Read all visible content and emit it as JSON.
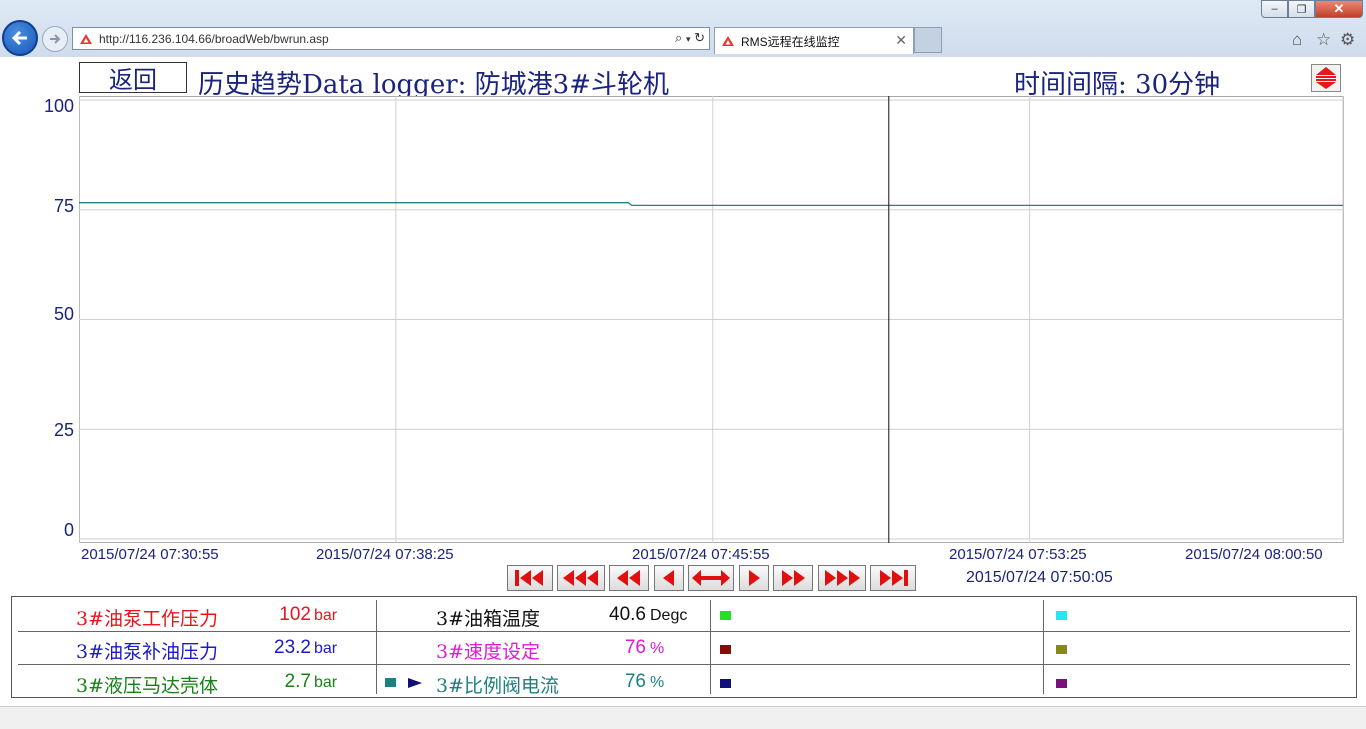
{
  "browser": {
    "address": "http://116.236.104.66/broadWeb/bwrun.asp",
    "tab_title": "RMS远程在线监控",
    "nav_icons": [
      "search-icon",
      "refresh-icon"
    ],
    "toolbar_icons": [
      "home-icon",
      "favorites-star-icon",
      "settings-gear-icon"
    ]
  },
  "header": {
    "back_label": "返回",
    "title": "历史趋势Data logger: 防城港3#斗轮机",
    "interval": "时间间隔: 30分钟"
  },
  "chart_data": {
    "type": "line",
    "y_ticks": [
      "100",
      "75",
      "50",
      "25",
      "0"
    ],
    "ylim": [
      0,
      100
    ],
    "x_ticks": [
      "2015/07/24 07:30:55",
      "2015/07/24 07:38:25",
      "2015/07/24 07:45:55",
      "2015/07/24 07:53:25",
      "2015/07/24 08:00:50"
    ],
    "cursor_time": "2015/07/24 07:50:05",
    "cursor_at": "2015/07/24 07:50:05",
    "series": [
      {
        "color": "#2a7e8a",
        "x": [
          "2015/07/24 07:30:55",
          "2015/07/24 07:43:55",
          "2015/07/24 07:44:00",
          "2015/07/24 08:00:50"
        ],
        "y": [
          76.6,
          76.6,
          76.0,
          76.0
        ]
      }
    ],
    "grid": true
  },
  "playback": [
    {
      "name": "first-button",
      "glyph": "first-icon"
    },
    {
      "name": "fast-rewind-button",
      "glyph": "fast-rewind-icon"
    },
    {
      "name": "rewind-button",
      "glyph": "rewind-icon"
    },
    {
      "name": "step-back-button",
      "glyph": "step-back-icon"
    },
    {
      "name": "center-button",
      "glyph": "center-icon"
    },
    {
      "name": "step-forward-button",
      "glyph": "step-forward-icon"
    },
    {
      "name": "forward-button",
      "glyph": "forward-icon"
    },
    {
      "name": "fast-forward-button",
      "glyph": "fast-forward-icon"
    },
    {
      "name": "last-button",
      "glyph": "last-icon"
    }
  ],
  "sensors": {
    "r1c1": {
      "label": "3#油泵工作压力",
      "value": "102",
      "unit": "bar",
      "color": "#e8141d"
    },
    "r2c1": {
      "label": "3#油泵补油压力",
      "value": "23.2",
      "unit": "bar",
      "color": "#1a1ac8"
    },
    "r3c1": {
      "label": "3#液压马达壳体",
      "value": "2.7",
      "unit": "bar",
      "color": "#188218"
    },
    "r1c2": {
      "label": "3#油箱温度",
      "value": "40.6",
      "unit": "Degc",
      "color": "#111111"
    },
    "r2c2": {
      "label": "3#速度设定",
      "value": "76",
      "unit": "%",
      "color": "#e01ad6"
    },
    "r3c2": {
      "label": "3#比例阀电流",
      "value": "76",
      "unit": "%",
      "color": "#1d8080"
    },
    "swatches": {
      "r3c1": "#1d8080",
      "c3": [
        "#22e022",
        "#8a0a0a",
        "#10107a"
      ],
      "c4": [
        "#22e8f0",
        "#8a8a10",
        "#7a107a"
      ]
    }
  }
}
